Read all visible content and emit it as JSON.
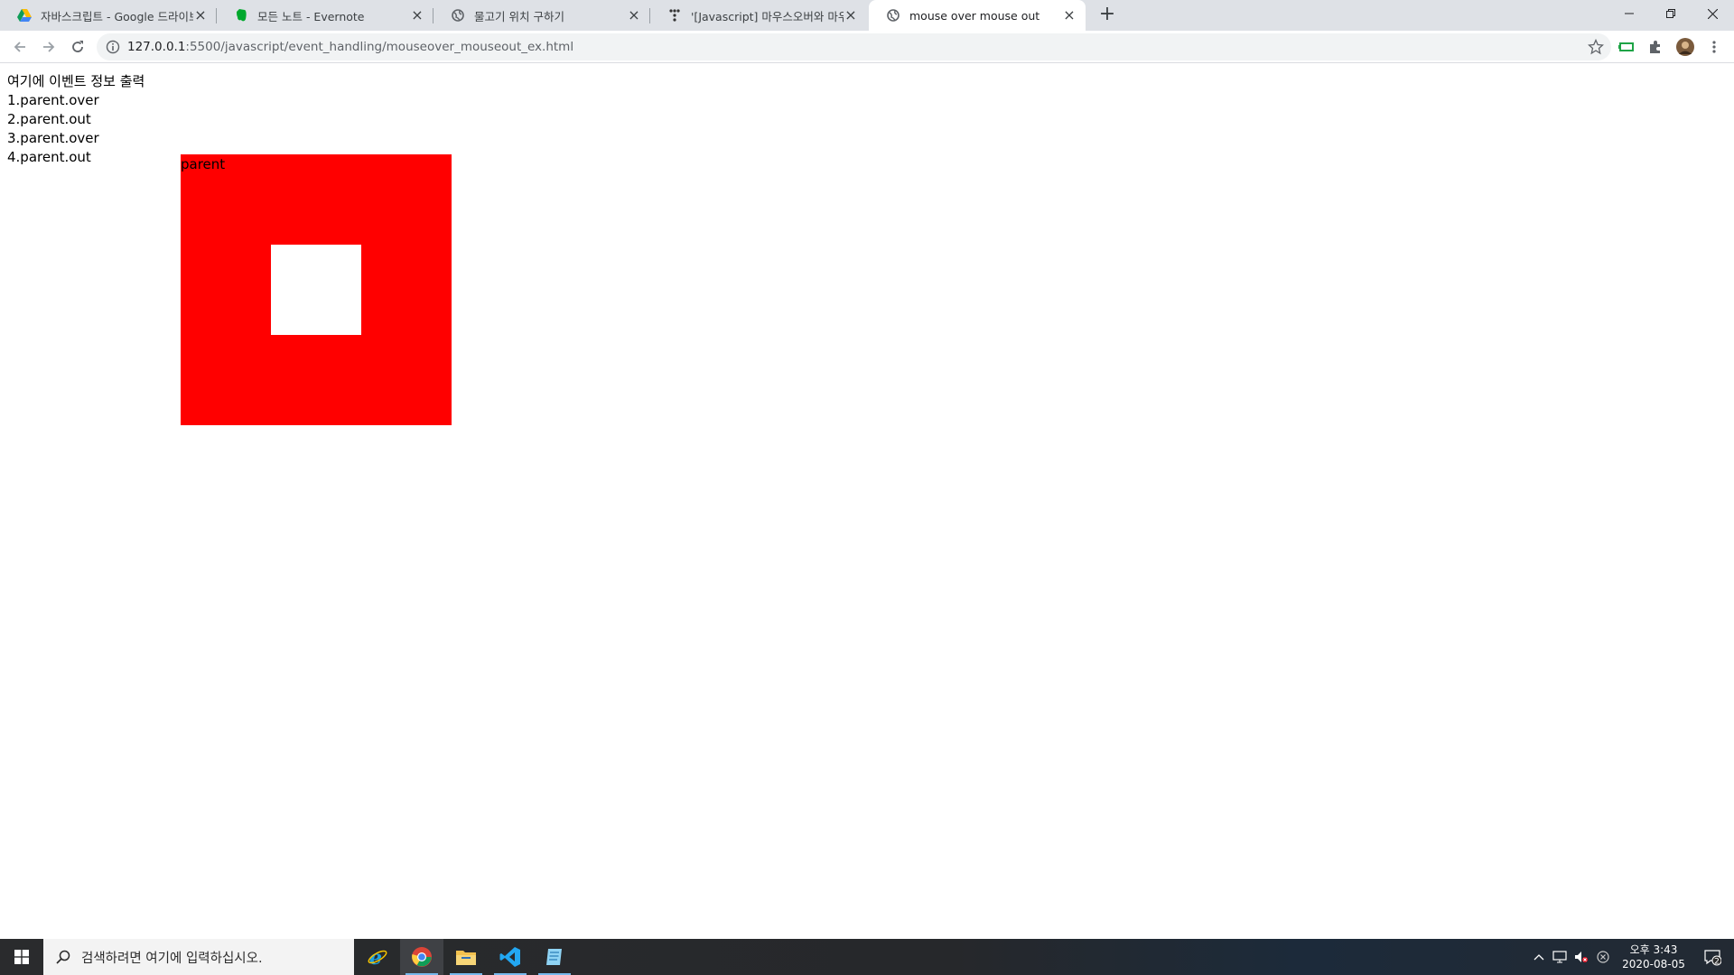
{
  "tabs": [
    {
      "title": "자바스크립트 - Google 드라이브",
      "icon": "google-drive-icon"
    },
    {
      "title": "모든 노트 - Evernote",
      "icon": "evernote-icon"
    },
    {
      "title": "물고기 위치 구하기",
      "icon": "globe-icon"
    },
    {
      "title": "'[Javascript] 마우스오버와 마우스아웃",
      "icon": "tistory-icon"
    },
    {
      "title": "mouse over mouse out",
      "icon": "globe-icon",
      "active": true
    }
  ],
  "toolbar": {
    "url_host": "127.0.0.1",
    "url_path": ":5500/javascript/event_handling/mouseover_mouseout_ex.html"
  },
  "page": {
    "heading": "여기에 이벤트 정보 출력",
    "log": [
      "1.parent.over",
      "2.parent.out",
      "3.parent.over",
      "4.parent.out"
    ],
    "parent_label": "parent",
    "parent_color": "#ff0000",
    "child_color": "#ffffff"
  },
  "taskbar": {
    "search_placeholder": "검색하려면 여기에 입력하십시오.",
    "apps": [
      "internet-explorer-icon",
      "chrome-icon",
      "file-explorer-icon",
      "vscode-icon",
      "notepad-icon"
    ],
    "time": "오후 3:43",
    "date": "2020-08-05",
    "notification_count": "2"
  }
}
